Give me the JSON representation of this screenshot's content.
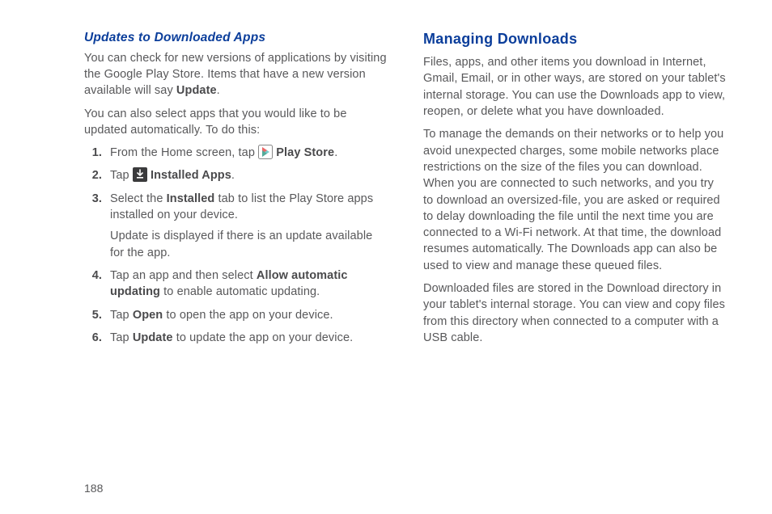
{
  "left": {
    "subheading": "Updates to Downloaded Apps",
    "p1a": "You can check for new versions of applications by visiting the Google Play Store. Items that have a new version available will say ",
    "p1b": "Update",
    "p1c": ".",
    "p2": "You can also select apps that you would like to be updated automatically. To do this:",
    "steps": {
      "s1": {
        "num": "1.",
        "a": "From the Home screen, tap ",
        "b": " Play Store",
        "c": "."
      },
      "s2": {
        "num": "2.",
        "a": "Tap ",
        "b": " Installed Apps",
        "c": "."
      },
      "s3": {
        "num": "3.",
        "a": "Select the ",
        "b": "Installed",
        "c": " tab to list the Play Store apps installed on your device.",
        "note": "Update is displayed if there is an update available for the app."
      },
      "s4": {
        "num": "4.",
        "a": "Tap an app and then select ",
        "b": "Allow automatic updating",
        "c": " to enable automatic updating."
      },
      "s5": {
        "num": "5.",
        "a": "Tap ",
        "b": "Open",
        "c": " to open the app on your device."
      },
      "s6": {
        "num": "6.",
        "a": "Tap ",
        "b": "Update",
        "c": " to update the app on your device."
      }
    }
  },
  "right": {
    "heading": "Managing Downloads",
    "p1": "Files, apps, and other items you download in Internet, Gmail, Email, or in other ways, are stored on your tablet's internal storage. You can use the Downloads app to view, reopen, or delete what you have downloaded.",
    "p2": "To manage the demands on their networks or to help you avoid unexpected charges, some mobile networks place restrictions on the size of the files you can download. When you are connected to such networks, and you try to download an oversized-file, you are asked or required to delay downloading the file until the next time you are connected to a Wi-Fi network. At that time, the download resumes automatically. The Downloads app can also be used to view and manage these queued files.",
    "p3": "Downloaded files are stored in the Download directory in your tablet's internal storage. You can view and copy files from this directory when connected to a computer with a USB cable."
  },
  "page_number": "188"
}
